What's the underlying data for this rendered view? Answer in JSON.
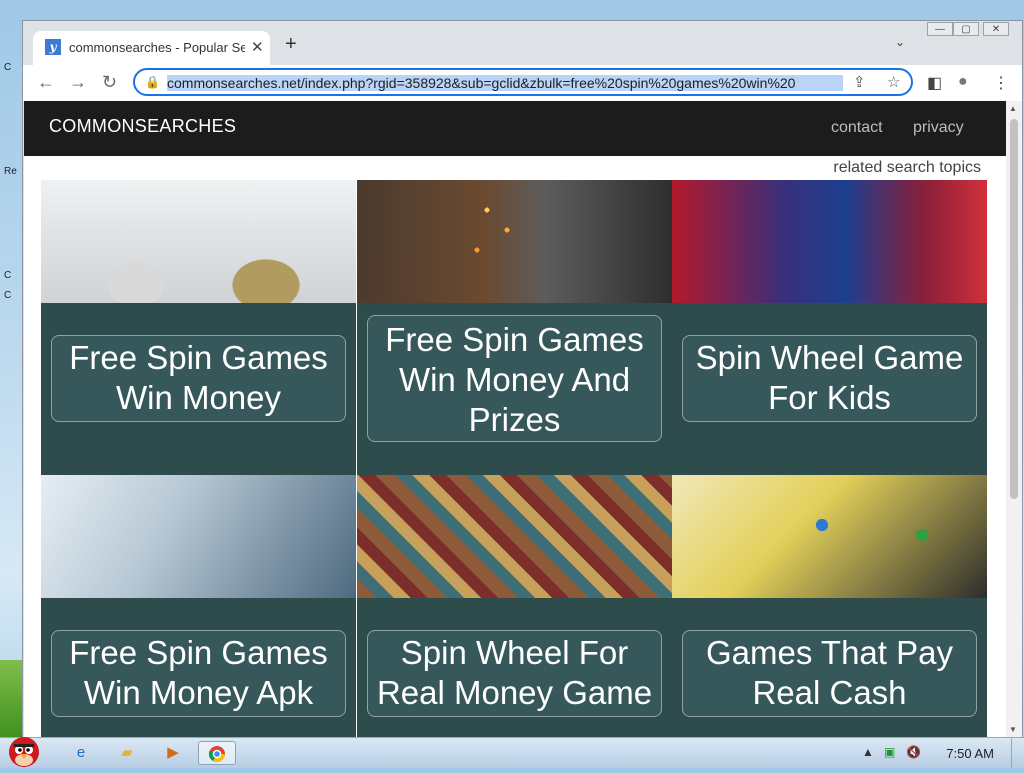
{
  "desktop": {
    "fragments": [
      "C",
      "Re",
      "C",
      "C"
    ]
  },
  "browser": {
    "tab": {
      "title": "commonsearches - Popular Se",
      "favicon": "y",
      "close_glyph": "✕"
    },
    "new_tab_glyph": "+",
    "tab_search_glyph": "⌄",
    "window_controls": [
      "—",
      "▢",
      "✕"
    ],
    "nav": {
      "back": "←",
      "forward": "→",
      "reload": "↻"
    },
    "address_bar": {
      "url": "commonsearches.net/index.php?rgid=358928&sub=gclid&zbulk=free%20spin%20games%20win%20"
    },
    "icons": {
      "share": "⇪",
      "bookmark": "☆",
      "sidepanel": "◧",
      "profile": "●",
      "menu": "⋮"
    }
  },
  "page": {
    "brand": "COMMONSEARCHES",
    "nav_links": [
      "contact",
      "privacy"
    ],
    "related_label": "related search topics",
    "cards": [
      {
        "label": "Free Spin Games Win Money",
        "image": "golden-egg-photo"
      },
      {
        "label": "Free Spin Games Win Money And Prizes",
        "image": "streaming-setup-photo"
      },
      {
        "label": "Spin Wheel Game For Kids",
        "image": "game-over-poster-photo"
      },
      {
        "label": "Free Spin Games Win Money Apk",
        "image": "glue-bottle-photo"
      },
      {
        "label": "Spin Wheel For Real Money Game",
        "image": "vintage-posters-photo"
      },
      {
        "label": "Games That Pay Real Cash",
        "image": "ludo-board-photo"
      }
    ]
  },
  "taskbar": {
    "apps": [
      "internet-explorer-icon",
      "folder-icon",
      "media-player-icon",
      "chrome-icon"
    ],
    "tray_icons": [
      "tray-expand-icon",
      "network-icon",
      "volume-muted-icon"
    ],
    "time": "7:50 AM"
  }
}
